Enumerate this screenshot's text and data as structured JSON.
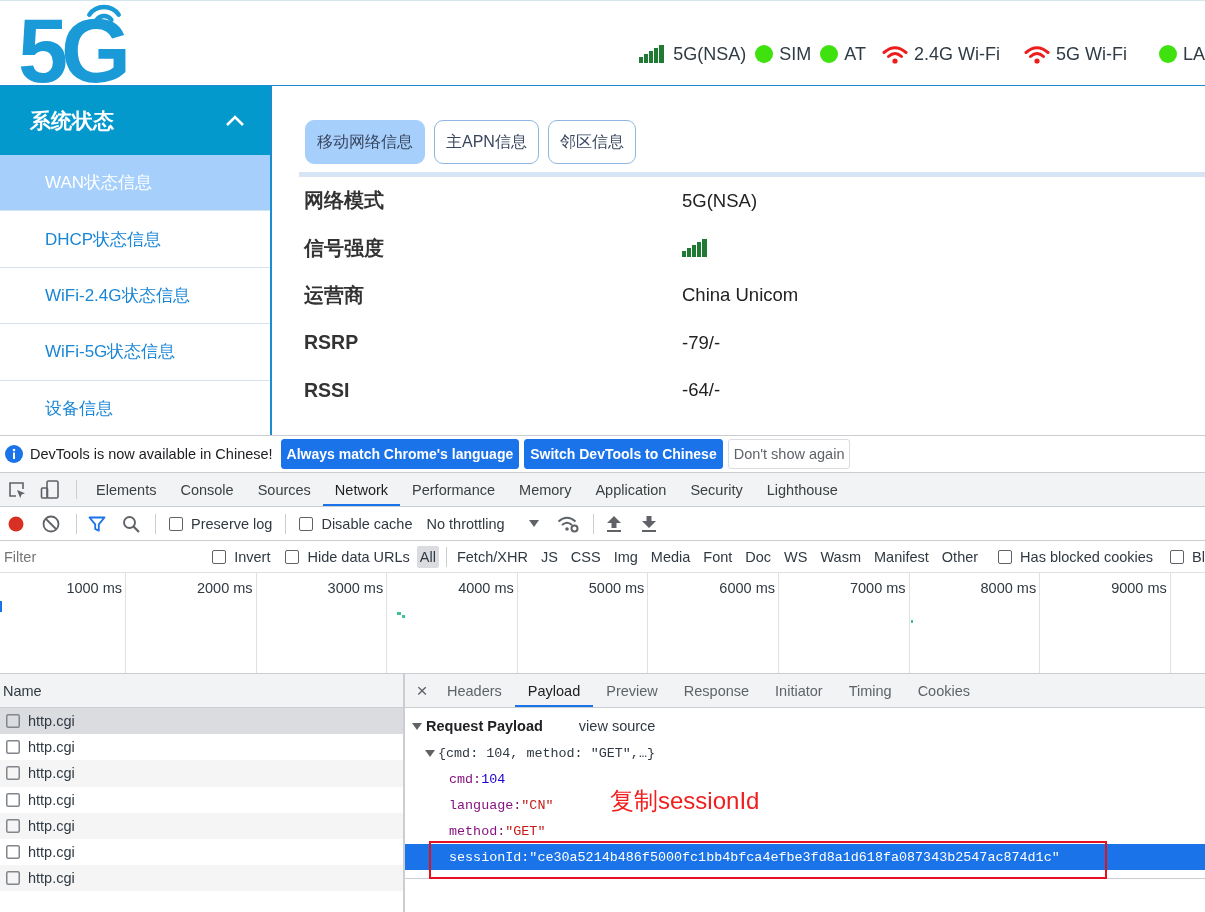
{
  "header": {
    "logo": "5G",
    "status": [
      {
        "kind": "signal",
        "label": "5G(NSA)"
      },
      {
        "kind": "dot",
        "label": "SIM"
      },
      {
        "kind": "dot",
        "label": "AT"
      },
      {
        "kind": "wifi",
        "label": "2.4G Wi-Fi"
      },
      {
        "kind": "wifi",
        "label": "5G Wi-Fi"
      },
      {
        "kind": "dot",
        "label": "LA"
      }
    ]
  },
  "sidebar": {
    "title": "系统状态",
    "expanded": true,
    "items": [
      {
        "label": "WAN状态信息",
        "selected": true
      },
      {
        "label": "DHCP状态信息",
        "selected": false
      },
      {
        "label": "WiFi-2.4G状态信息",
        "selected": false
      },
      {
        "label": "WiFi-5G状态信息",
        "selected": false
      },
      {
        "label": "设备信息",
        "selected": false
      }
    ]
  },
  "content": {
    "tabs": [
      {
        "label": "移动网络信息",
        "selected": true
      },
      {
        "label": "主APN信息",
        "selected": false
      },
      {
        "label": "邻区信息",
        "selected": false
      }
    ],
    "rows": [
      {
        "label": "网络模式",
        "kind": "text",
        "value": "5G(NSA)"
      },
      {
        "label": "信号强度",
        "kind": "signal"
      },
      {
        "label": "运营商",
        "kind": "text",
        "value": "China Unicom"
      },
      {
        "label": "RSRP",
        "kind": "text",
        "value": "-79/-"
      },
      {
        "label": "RSSI",
        "kind": "text",
        "value": "-64/-"
      }
    ]
  },
  "devtools": {
    "notice": {
      "message": "DevTools is now available in Chinese!",
      "buttons": [
        {
          "label": "Always match Chrome's language",
          "kind": "primary"
        },
        {
          "label": "Switch DevTools to Chinese",
          "kind": "primary"
        },
        {
          "label": "Don't show again",
          "kind": "secondary"
        }
      ]
    },
    "panels": [
      {
        "label": "Elements",
        "selected": false
      },
      {
        "label": "Console",
        "selected": false
      },
      {
        "label": "Sources",
        "selected": false
      },
      {
        "label": "Network",
        "selected": true
      },
      {
        "label": "Performance",
        "selected": false
      },
      {
        "label": "Memory",
        "selected": false
      },
      {
        "label": "Application",
        "selected": false
      },
      {
        "label": "Security",
        "selected": false
      },
      {
        "label": "Lighthouse",
        "selected": false
      }
    ],
    "toolbar": {
      "recording": true,
      "filter_active": true,
      "options": [
        {
          "label": "Preserve log",
          "checked": false
        },
        {
          "label": "Disable cache",
          "checked": false
        }
      ],
      "throttling": "No throttling"
    },
    "filter_bar": {
      "placeholder": "Filter",
      "options": [
        {
          "label": "Invert",
          "checked": false
        },
        {
          "label": "Hide data URLs",
          "checked": false
        }
      ],
      "types": [
        {
          "label": "All",
          "selected": true
        },
        {
          "label": "Fetch/XHR",
          "selected": false
        },
        {
          "label": "JS",
          "selected": false
        },
        {
          "label": "CSS",
          "selected": false
        },
        {
          "label": "Img",
          "selected": false
        },
        {
          "label": "Media",
          "selected": false
        },
        {
          "label": "Font",
          "selected": false
        },
        {
          "label": "Doc",
          "selected": false
        },
        {
          "label": "WS",
          "selected": false
        },
        {
          "label": "Wasm",
          "selected": false
        },
        {
          "label": "Manifest",
          "selected": false
        },
        {
          "label": "Other",
          "selected": false
        }
      ],
      "more_options": [
        {
          "label": "Has blocked cookies",
          "checked": false
        },
        {
          "label": "Bl",
          "checked": false
        }
      ]
    },
    "timeline": {
      "ticks": [
        "1000 ms",
        "2000 ms",
        "3000 ms",
        "4000 ms",
        "5000 ms",
        "6000 ms",
        "7000 ms",
        "8000 ms",
        "9000 ms"
      ]
    },
    "requests": {
      "column": "Name",
      "rows": [
        {
          "name": "http.cgi",
          "selected": true
        },
        {
          "name": "http.cgi",
          "selected": false
        },
        {
          "name": "http.cgi",
          "selected": false
        },
        {
          "name": "http.cgi",
          "selected": false
        },
        {
          "name": "http.cgi",
          "selected": false
        },
        {
          "name": "http.cgi",
          "selected": false
        },
        {
          "name": "http.cgi",
          "selected": false
        }
      ]
    },
    "details": {
      "close": "×",
      "tabs": [
        {
          "label": "Headers",
          "selected": false
        },
        {
          "label": "Payload",
          "selected": true
        },
        {
          "label": "Preview",
          "selected": false
        },
        {
          "label": "Response",
          "selected": false
        },
        {
          "label": "Initiator",
          "selected": false
        },
        {
          "label": "Timing",
          "selected": false
        },
        {
          "label": "Cookies",
          "selected": false
        }
      ],
      "section": {
        "title": "Request Payload",
        "expanded": true,
        "link": "view source"
      },
      "payload": {
        "summary": "{cmd: 104, method: \"GET\",…}",
        "expanded": true,
        "fields": [
          {
            "key": "cmd:",
            "value": "104",
            "kind": "number",
            "selected": false
          },
          {
            "key": "language:",
            "value": "\"CN\"",
            "kind": "string",
            "selected": false
          },
          {
            "key": "method:",
            "value": "\"GET\"",
            "kind": "string",
            "selected": false
          },
          {
            "key": "sessionId:",
            "value": "\"ce30a5214b486f5000fc1bb4bfca4efbe3fd8a1d618fa087343b2547ac874d1c\"",
            "kind": "string",
            "selected": true
          }
        ]
      }
    }
  },
  "annotation": {
    "text": "复制sessionId"
  }
}
